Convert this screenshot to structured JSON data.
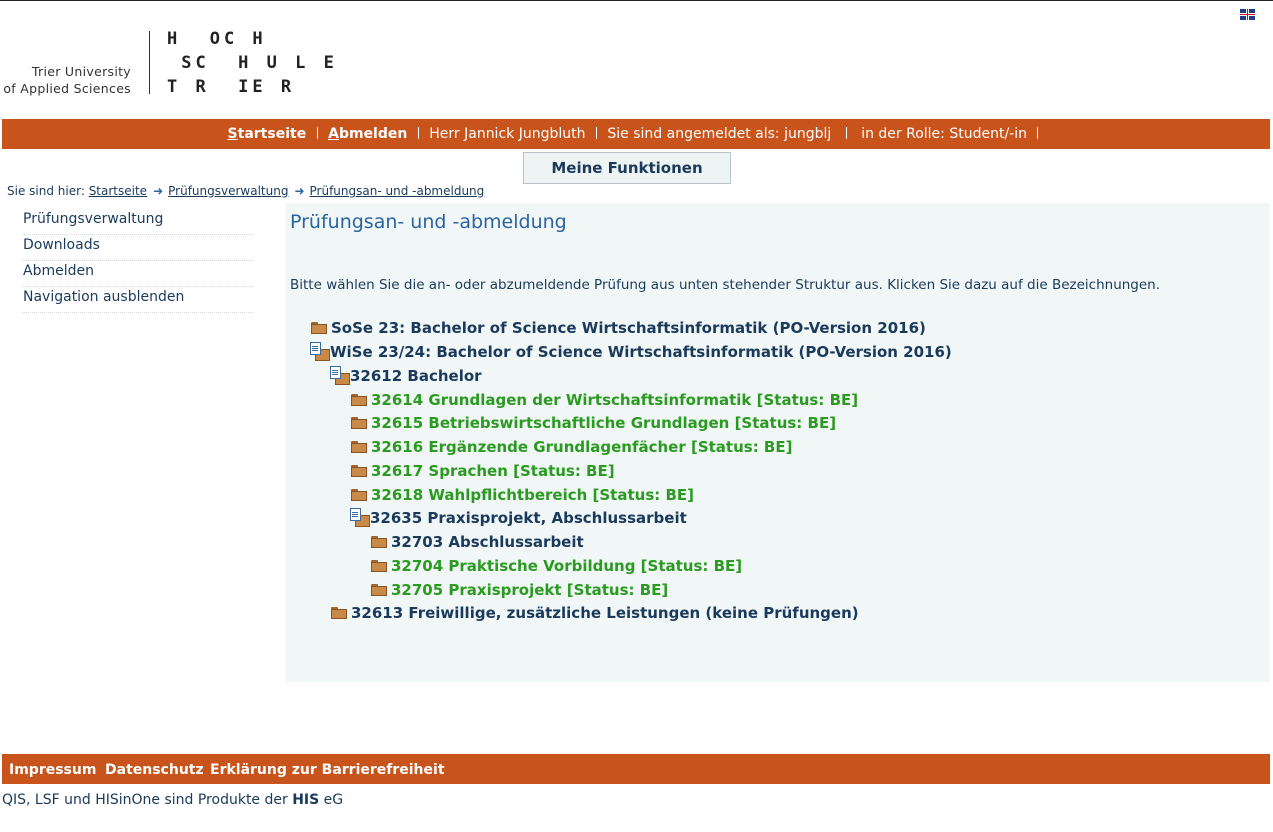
{
  "header": {
    "university_line1": "Trier University",
    "university_line2": "of Applied Sciences",
    "logo_row1": "H  OC H",
    "logo_row2": " SC  H U L E",
    "logo_row3": "T R  IE R",
    "language_flag": "uk-flag-icon"
  },
  "topbar": {
    "startseite": "Startseite",
    "startseite_accesskey": "S",
    "startseite_rest": "tartseite",
    "abmelden_accesskey": "A",
    "abmelden_rest": "bmelden",
    "user": "Herr Jannick Jungbluth",
    "logged_in_as": "Sie sind angemeldet als: jungblj",
    "role": "in der Rolle: Student/-in",
    "color": "#c8531b"
  },
  "functions_button": "Meine Funktionen",
  "breadcrumb": {
    "prefix": "Sie sind hier:",
    "items": [
      "Startseite",
      "Prüfungsverwaltung",
      "Prüfungsan- und -abmeldung"
    ]
  },
  "sidebar": {
    "items": [
      {
        "label": "Prüfungsverwaltung"
      },
      {
        "label": "Downloads"
      },
      {
        "label": "Abmelden"
      },
      {
        "label": "Navigation ausblenden"
      }
    ]
  },
  "main": {
    "title": "Prüfungsan- und -abmeldung",
    "intro": "Bitte wählen Sie die an- oder abzumeldende Prüfung aus unten stehender Struktur aus. Klicken Sie dazu auf die Bezeichnungen.",
    "tree": [
      {
        "label": "SoSe 23: Bachelor of Science Wirtschaftsinformatik (PO-Version 2016)",
        "color": "blue",
        "icon": "folder-icon"
      },
      {
        "label": "WiSe 23/24: Bachelor of Science Wirtschaftsinformatik (PO-Version 2016)",
        "color": "blue",
        "icon": "open-folder-doc-icon"
      },
      {
        "label": "32612 Bachelor",
        "color": "blue",
        "icon": "open-folder-doc-icon"
      },
      {
        "label": "32614 Grundlagen der Wirtschaftsinformatik [Status: BE]",
        "color": "green",
        "icon": "folder-icon"
      },
      {
        "label": "32615 Betriebswirtschaftliche Grundlagen [Status: BE]",
        "color": "green",
        "icon": "folder-icon"
      },
      {
        "label": "32616 Ergänzende Grundlagenfächer [Status: BE]",
        "color": "green",
        "icon": "folder-icon"
      },
      {
        "label": "32617 Sprachen [Status: BE]",
        "color": "green",
        "icon": "folder-icon"
      },
      {
        "label": "32618 Wahlpflichtbereich [Status: BE]",
        "color": "green",
        "icon": "folder-icon"
      },
      {
        "label": "32635 Praxisprojekt, Abschlussarbeit",
        "color": "blue",
        "icon": "open-folder-doc-icon"
      },
      {
        "label": "32703 Abschlussarbeit",
        "color": "blue",
        "icon": "folder-icon"
      },
      {
        "label": "32704 Praktische Vorbildung [Status: BE]",
        "color": "green",
        "icon": "folder-icon"
      },
      {
        "label": "32705 Praxisprojekt [Status: BE]",
        "color": "green",
        "icon": "folder-icon"
      },
      {
        "label": "32613 Freiwillige, zusätzliche Leistungen (keine Prüfungen)",
        "color": "blue",
        "icon": "folder-icon"
      }
    ]
  },
  "footer": {
    "links": [
      "Impressum",
      "Datenschutz",
      "Erklärung zur Barrierefreiheit"
    ],
    "products_prefix": "QIS, LSF und HISinOne sind Produkte der",
    "products_his": "HIS",
    "products_suffix": "eG"
  }
}
